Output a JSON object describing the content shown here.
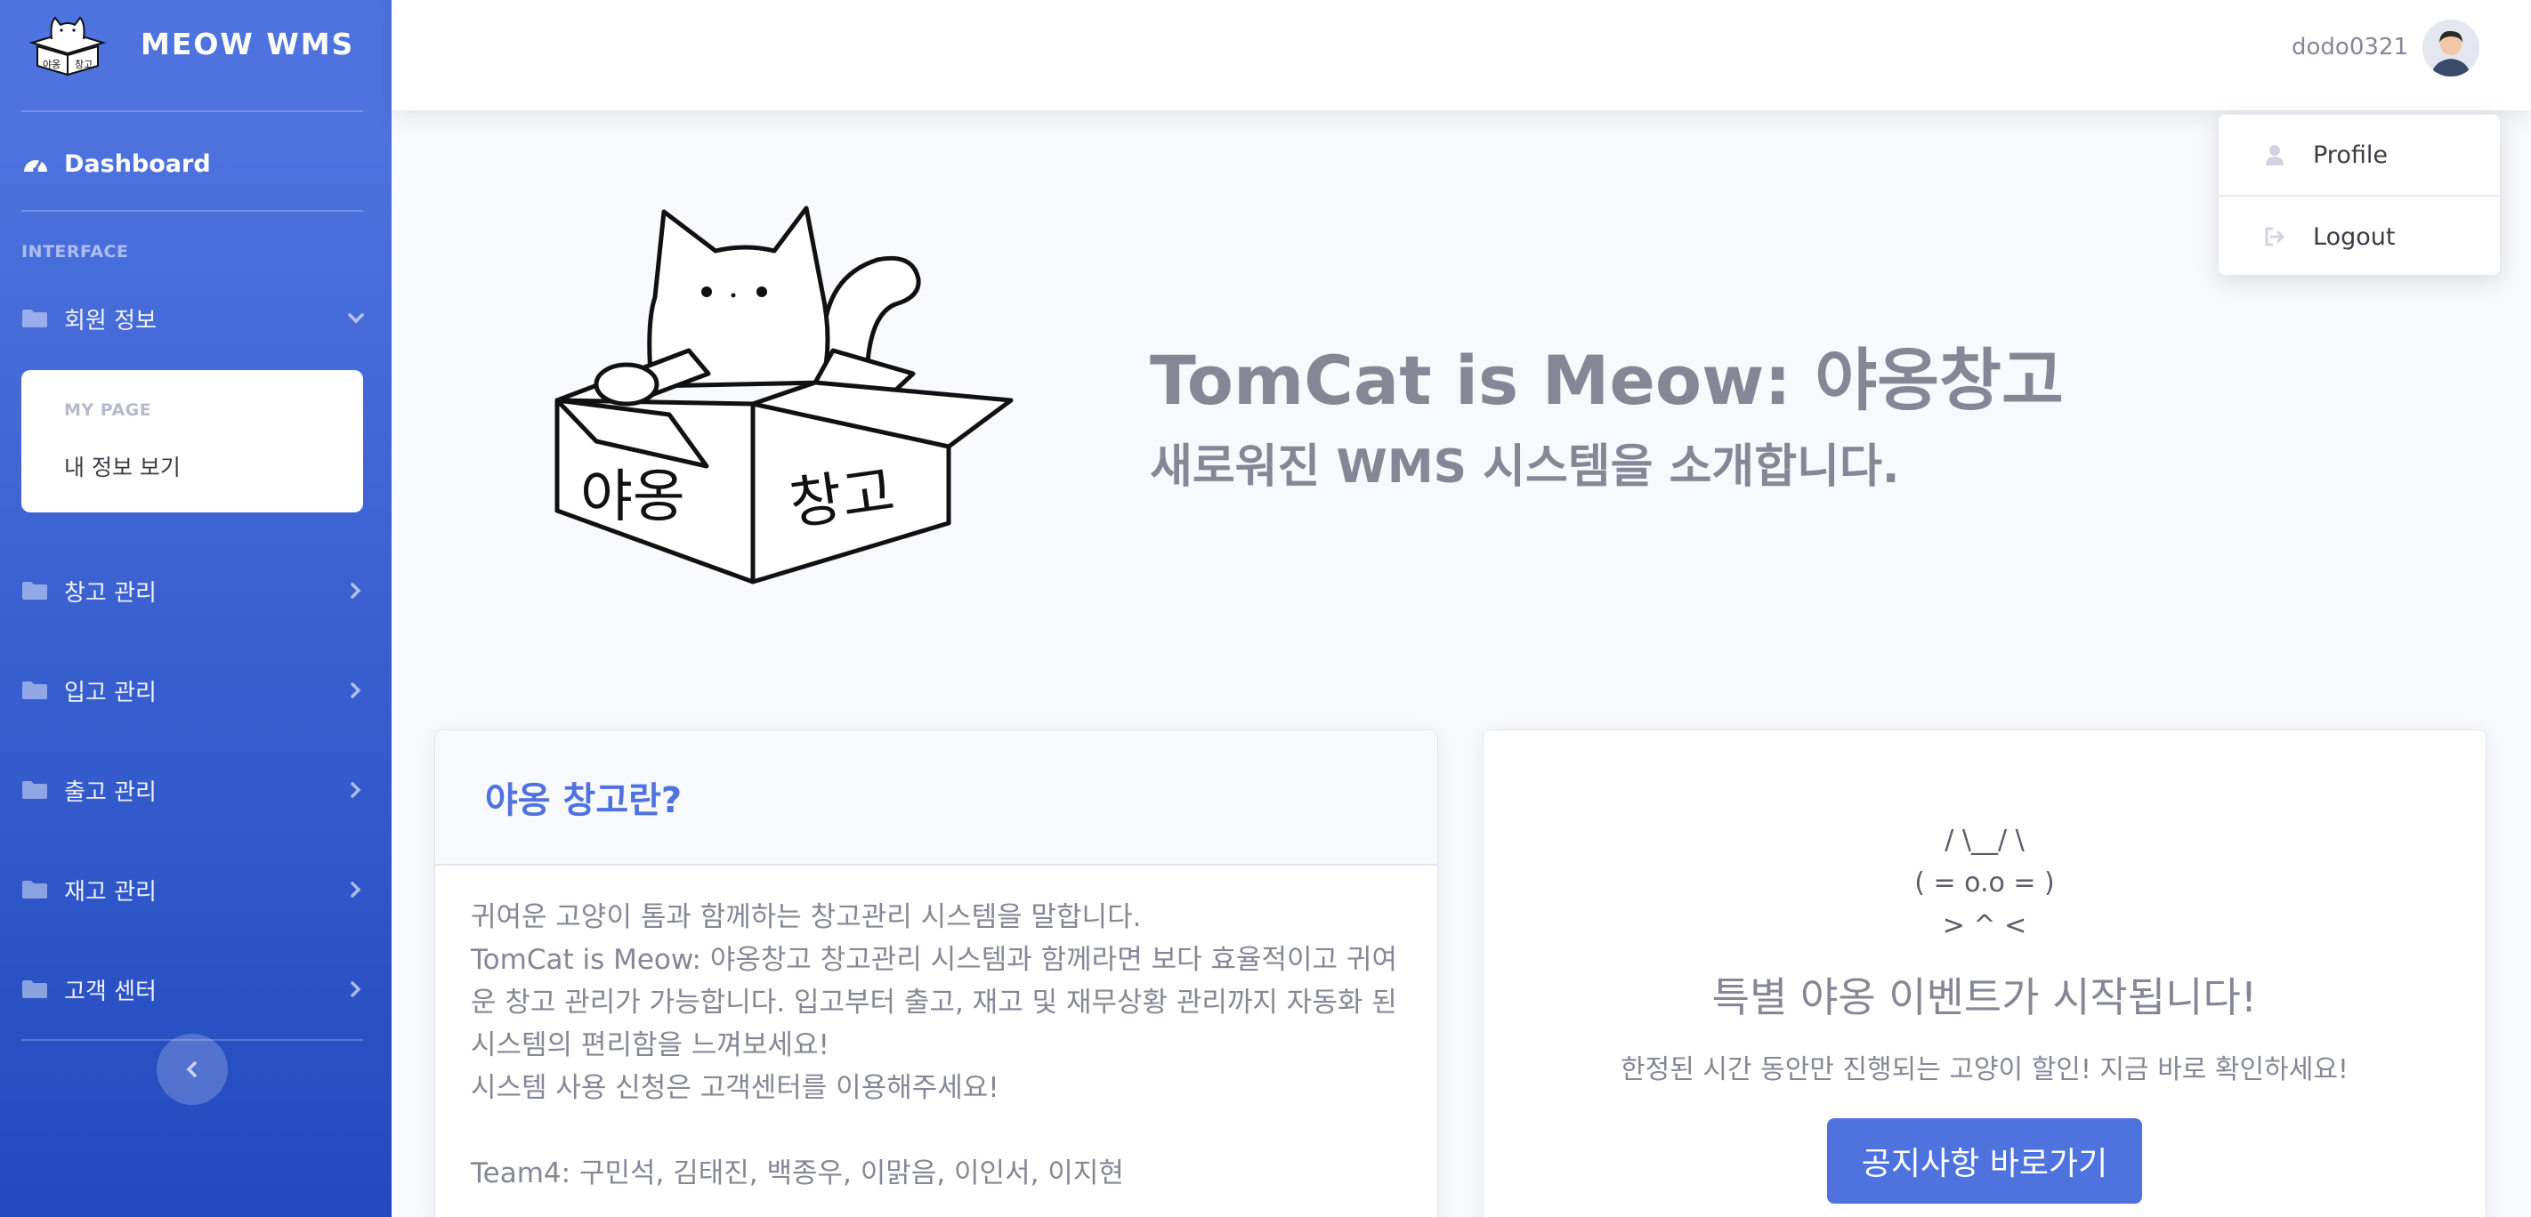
{
  "brand": {
    "name": "MEOW WMS",
    "logo_text": [
      "야옹",
      "창고"
    ]
  },
  "sidebar": {
    "dashboard_label": "Dashboard",
    "heading": "INTERFACE",
    "items": [
      {
        "label": "회원 정보",
        "expanded": true
      },
      {
        "label": "창고 관리",
        "expanded": false
      },
      {
        "label": "입고 관리",
        "expanded": false
      },
      {
        "label": "출고 관리",
        "expanded": false
      },
      {
        "label": "재고 관리",
        "expanded": false
      },
      {
        "label": "고객 센터",
        "expanded": false
      }
    ],
    "submenu": {
      "heading": "MY PAGE",
      "item": "내 정보 보기"
    }
  },
  "topbar": {
    "username": "dodo0321"
  },
  "user_menu": {
    "profile": "Profile",
    "logout": "Logout"
  },
  "hero": {
    "title": "TomCat is Meow: 야옹창고",
    "subtitle": "새로워진 WMS 시스템을 소개합니다.",
    "box_text": [
      "야옹",
      "창고"
    ]
  },
  "about_card": {
    "title": "야옹 창고란?",
    "lines": [
      "귀여운 고양이 톰과 함께하는 창고관리 시스템을 말합니다.",
      "TomCat is Meow: 야옹창고 창고관리 시스템과 함께라면 보다 효율적이고 귀여운 창고 관리가 가능합니다. 입고부터 출고, 재고 및 재무상황 관리까지 자동화 된 시스템의 편리함을 느껴보세요!",
      "시스템 사용 신청은 고객센터를 이용해주세요!"
    ],
    "team": "Team4: 구민석, 김태진, 백종우, 이맑음, 이인서, 이지현"
  },
  "event_card": {
    "ascii": [
      "/ \\__/ \\",
      "( = o.o = )",
      "> ^ <"
    ],
    "title": "특별 야옹 이벤트가 시작됩니다!",
    "description": "한정된 시간 동안만 진행되는 고양이 할인! 지금 바로 확인하세요!",
    "button_label": "공지사항 바로가기"
  },
  "colors": {
    "primary": "#4e73df",
    "sidebar_end": "#224abe",
    "text": "#858796"
  }
}
